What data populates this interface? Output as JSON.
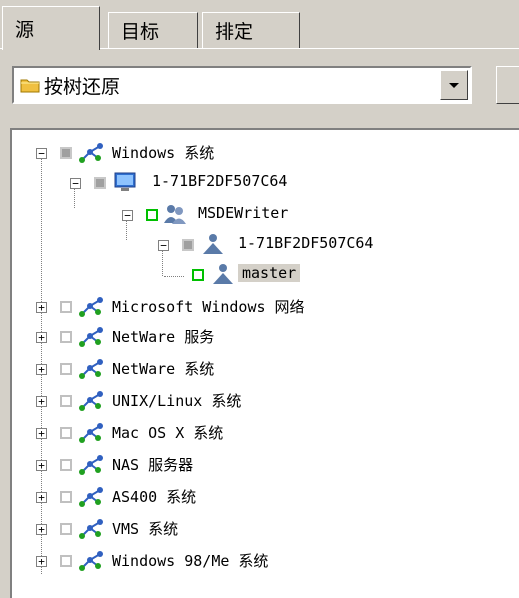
{
  "tabs": [
    {
      "label": "源"
    },
    {
      "label": "目标"
    },
    {
      "label": "排定"
    }
  ],
  "source_dropdown": {
    "selected": "按树还原",
    "icon": "folder-icon"
  },
  "tree": {
    "windows_system": "Windows 系统",
    "computer": "1-71BF2DF507C64",
    "msde_writer": "MSDEWriter",
    "instance": "1-71BF2DF507C64",
    "master": "master",
    "ms_network": "Microsoft Windows 网络",
    "netware_services": "NetWare 服务",
    "netware_systems": "NetWare 系统",
    "unix_linux": "UNIX/Linux 系统",
    "mac_os_x": "Mac OS X 系统",
    "nas": "NAS 服务器",
    "as400": "AS400 系统",
    "vms": "VMS 系统",
    "win98me": "Windows 98/Me 系统"
  },
  "colors": {
    "window_bg": "#d4d0c8",
    "checked_green": "#00c000",
    "network_icon_blue": "#3060c0",
    "network_icon_green": "#20a020"
  }
}
